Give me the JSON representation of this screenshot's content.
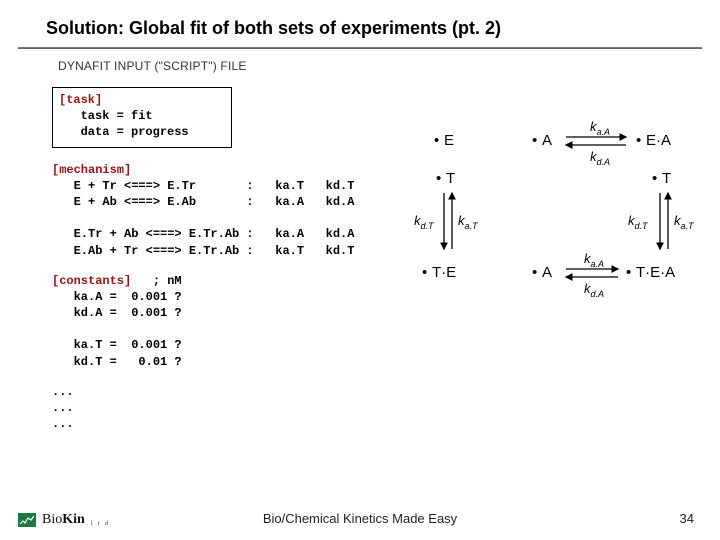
{
  "title": "Solution: Global fit of both sets of experiments (pt. 2)",
  "subhead": "DYNAFIT INPUT (\"SCRIPT\") FILE",
  "script": {
    "task_section": "[task]",
    "task_lines": "   task = fit\n   data = progress",
    "mech_section": "[mechanism]",
    "mech_lines": "   E + Tr <===> E.Tr       :   ka.T   kd.T\n   E + Ab <===> E.Ab       :   ka.A   kd.A\n\n   E.Tr + Ab <===> E.Tr.Ab :   ka.A   kd.A\n   E.Ab + Tr <===> E.Tr.Ab :   ka.T   kd.T",
    "const_section": "[constants]",
    "const_after": "   ; nM",
    "const_lines": "   ka.A =  0.001 ?\n   kd.A =  0.001 ?\n\n   ka.T =  0.001 ?\n   kd.T =   0.01 ?",
    "ellipsis": "...\n...\n..."
  },
  "diagram": {
    "species": {
      "E": "E",
      "A": "A",
      "T": "T",
      "EA": "E·A",
      "TE": "T·E",
      "TEA": "T·E·A"
    },
    "rates": {
      "kaA": "k",
      "kaA_sub": "a.A",
      "kdA": "k",
      "kdA_sub": "d.A",
      "kaT": "k",
      "kaT_sub": "a.T",
      "kdT": "k",
      "kdT_sub": "d.T"
    },
    "bullet": "•"
  },
  "footer": "Bio/Chemical Kinetics Made Easy",
  "page": "34",
  "logo": {
    "brand1": "Bio",
    "brand2": "Kin",
    "sub": "l t d"
  }
}
